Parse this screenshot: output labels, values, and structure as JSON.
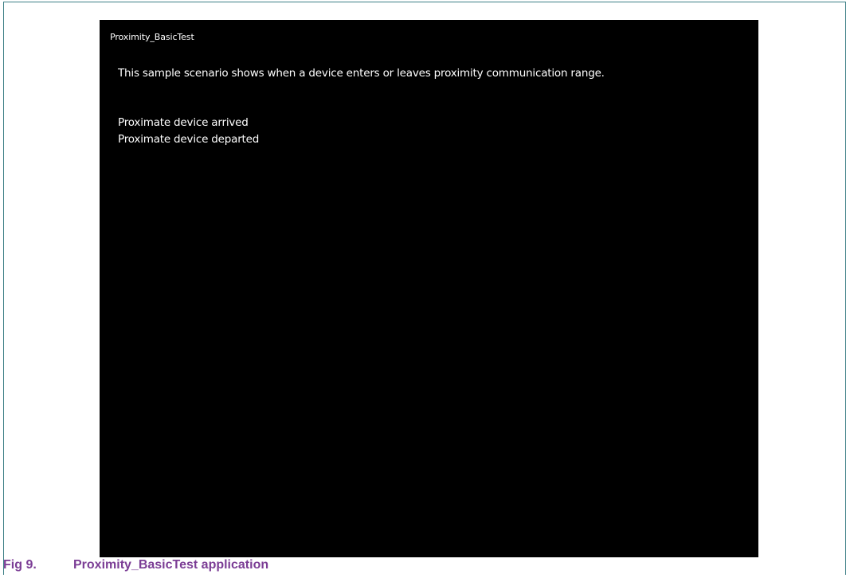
{
  "app": {
    "title": "Proximity_BasicTest",
    "description": "This sample scenario shows when a device enters or leaves  proximity communication range.",
    "events": [
      "Proximate device arrived",
      "Proximate device departed"
    ]
  },
  "caption": {
    "number": "Fig 9.",
    "text": "Proximity_BasicTest application"
  },
  "colors": {
    "frame": "#3d7f86",
    "app_background": "#000000",
    "app_text": "#ffffff",
    "caption": "#7b3d95"
  }
}
